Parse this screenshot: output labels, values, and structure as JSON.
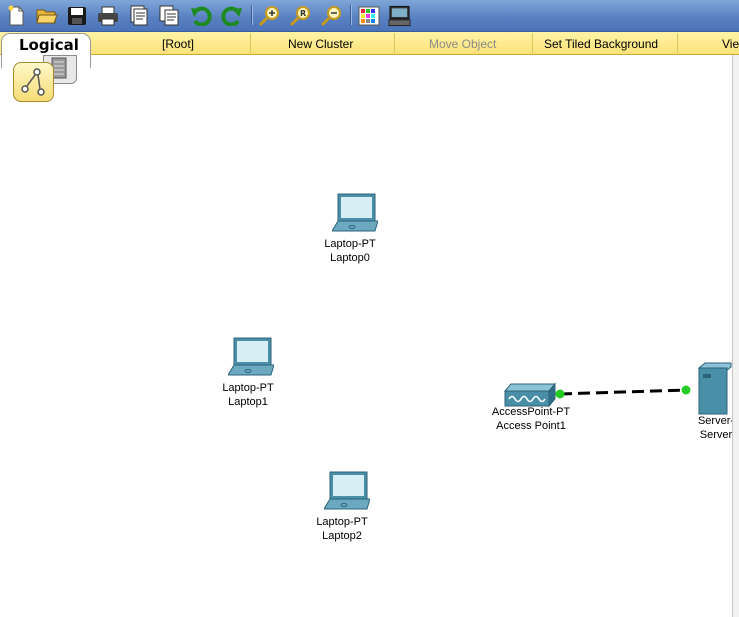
{
  "toolbar": {
    "buttons": [
      {
        "name": "new-icon"
      },
      {
        "name": "open-icon"
      },
      {
        "name": "save-icon"
      },
      {
        "name": "print-icon"
      },
      {
        "name": "activity-wizard-icon"
      },
      {
        "name": "copy-icon"
      },
      {
        "name": "undo-icon"
      },
      {
        "name": "redo-icon"
      },
      {
        "name": "zoom-in-icon"
      },
      {
        "name": "zoom-reset-icon"
      },
      {
        "name": "zoom-out-icon"
      },
      {
        "name": "palette-icon"
      },
      {
        "name": "custom-device-icon"
      }
    ]
  },
  "logical_bar": {
    "tab_label": "Logical",
    "root_label": "[Root]",
    "new_cluster_label": "New Cluster",
    "move_object_label": "Move Object",
    "set_background_label": "Set Tiled Background",
    "view_label": "Vie"
  },
  "devices": [
    {
      "model": "Laptop-PT",
      "name": "Laptop0"
    },
    {
      "model": "Laptop-PT",
      "name": "Laptop1"
    },
    {
      "model": "Laptop-PT",
      "name": "Laptop2"
    },
    {
      "model": "AccessPoint-PT",
      "name": "Access Point1"
    },
    {
      "model": "Server-",
      "name": "Server"
    }
  ],
  "colors": {
    "toolbar": "#5a82c2",
    "logical_bar": "#fbe27a",
    "device_teal": "#4a8fa8",
    "link_endpoint": "#22cc22",
    "link_line": "#000000"
  }
}
